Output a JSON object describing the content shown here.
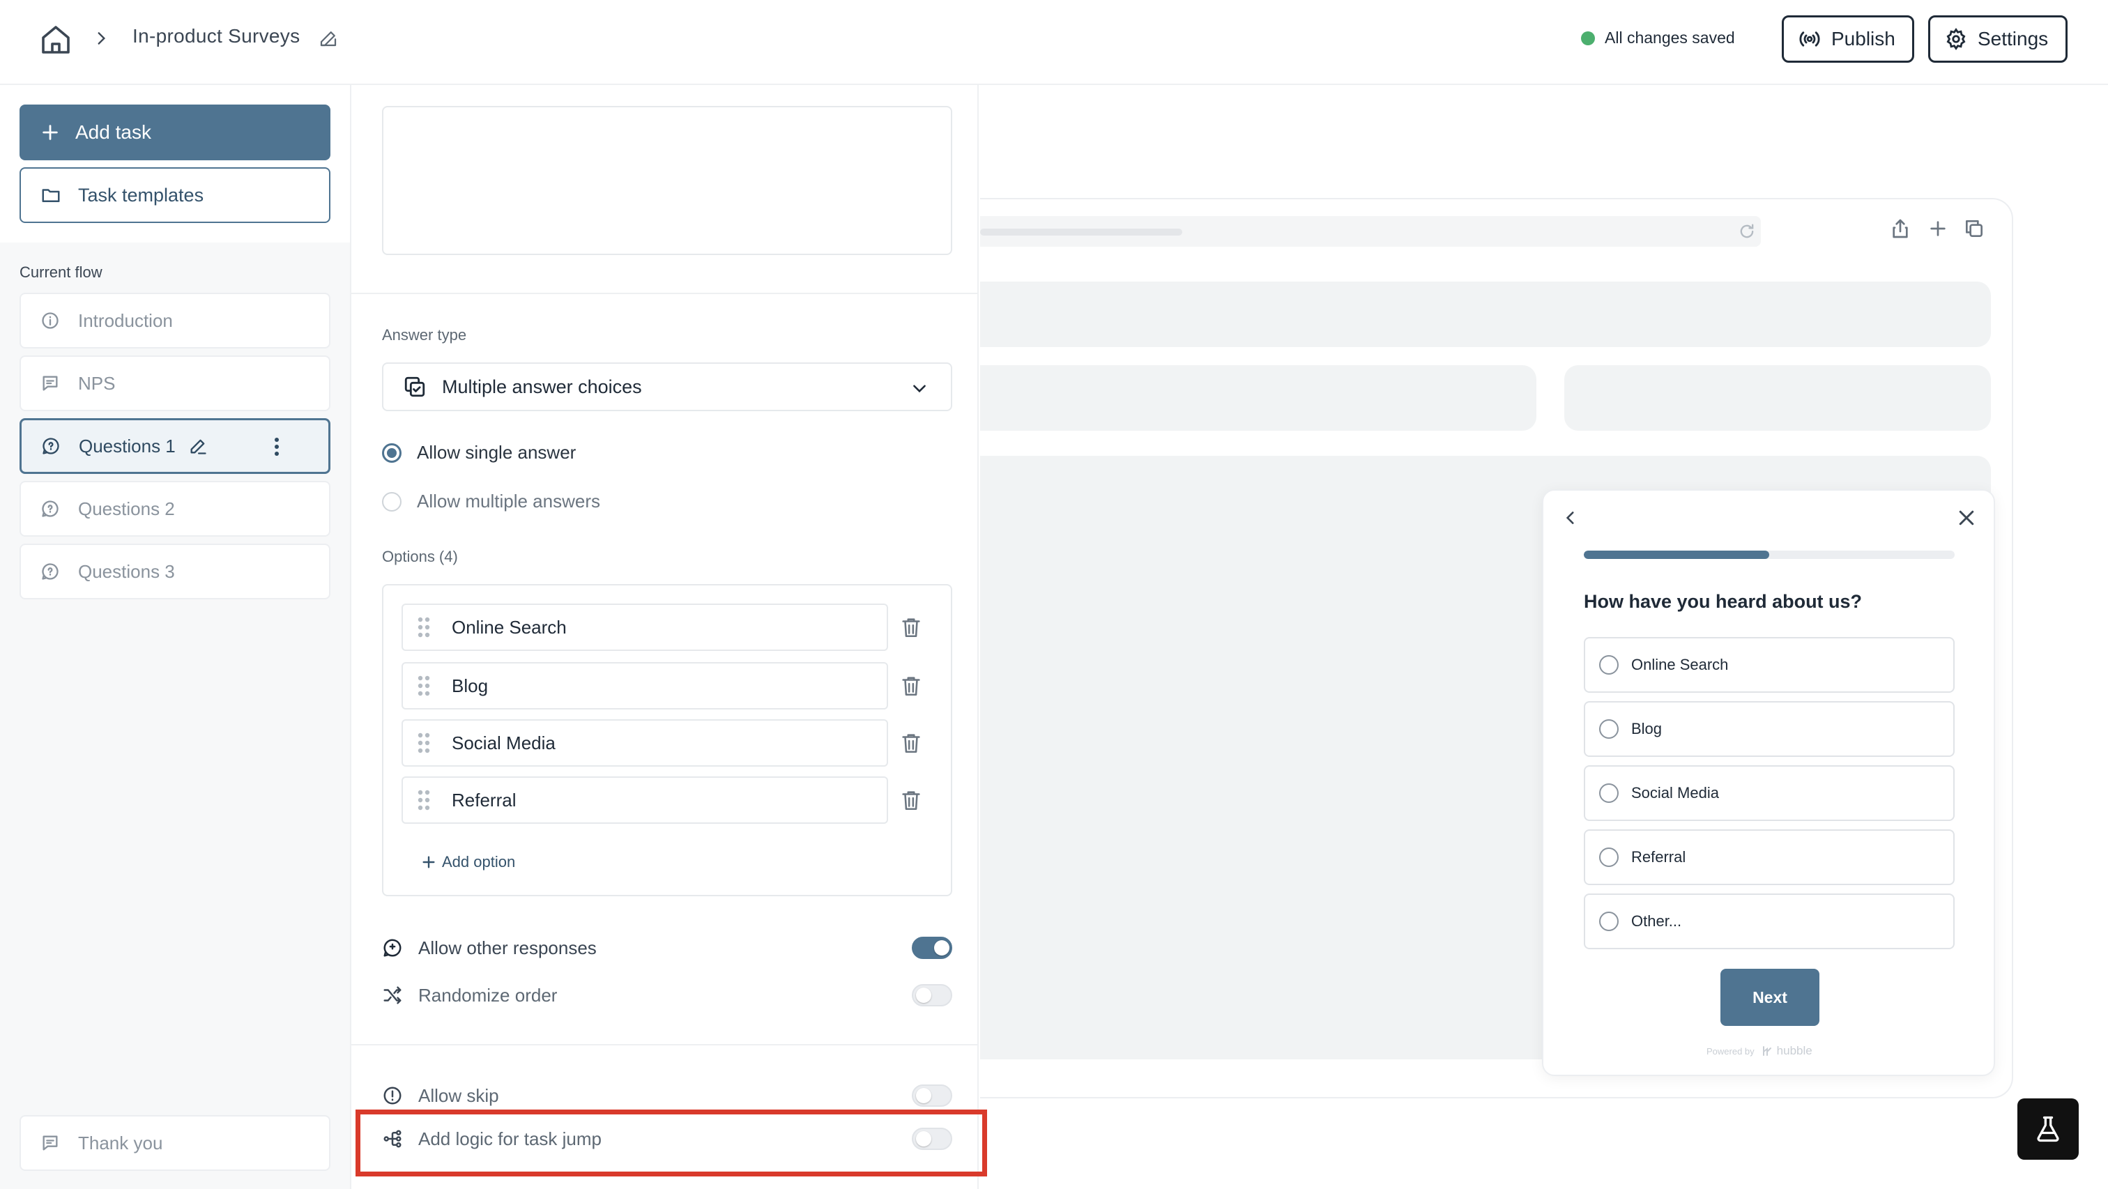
{
  "header": {
    "breadcrumb_title": "In-product Surveys",
    "save_status": "All changes saved",
    "status_color": "#4caf6e",
    "publish_label": "Publish",
    "settings_label": "Settings"
  },
  "sidebar": {
    "add_task_label": "Add task",
    "templates_label": "Task templates",
    "flow_label": "Current flow",
    "items": [
      {
        "label": "Introduction",
        "icon": "info-icon"
      },
      {
        "label": "NPS",
        "icon": "message-icon"
      },
      {
        "label": "Questions 1",
        "icon": "question-icon",
        "active": true
      },
      {
        "label": "Questions 2",
        "icon": "question-icon"
      },
      {
        "label": "Questions 3",
        "icon": "question-icon"
      }
    ],
    "thank_you_label": "Thank you"
  },
  "editor": {
    "answer_type_label": "Answer type",
    "answer_type_value": "Multiple answer choices",
    "single_answer_label": "Allow single answer",
    "multiple_answers_label": "Allow multiple answers",
    "options_label": "Options (4)",
    "options": [
      "Online Search",
      "Blog",
      "Social Media",
      "Referral"
    ],
    "add_option_label": "Add option",
    "allow_other_label": "Allow other responses",
    "randomize_label": "Randomize order",
    "allow_skip_label": "Allow skip",
    "logic_jump_label": "Add logic for task jump"
  },
  "preview": {
    "question": "How have you heard about us?",
    "progress_fraction": 0.5,
    "options": [
      "Online Search",
      "Blog",
      "Social Media",
      "Referral",
      "Other..."
    ],
    "next_label": "Next",
    "powered_by": "Powered by",
    "brand": "hubble"
  },
  "colors": {
    "accent": "#4f7491",
    "highlight": "#d93a2b"
  }
}
